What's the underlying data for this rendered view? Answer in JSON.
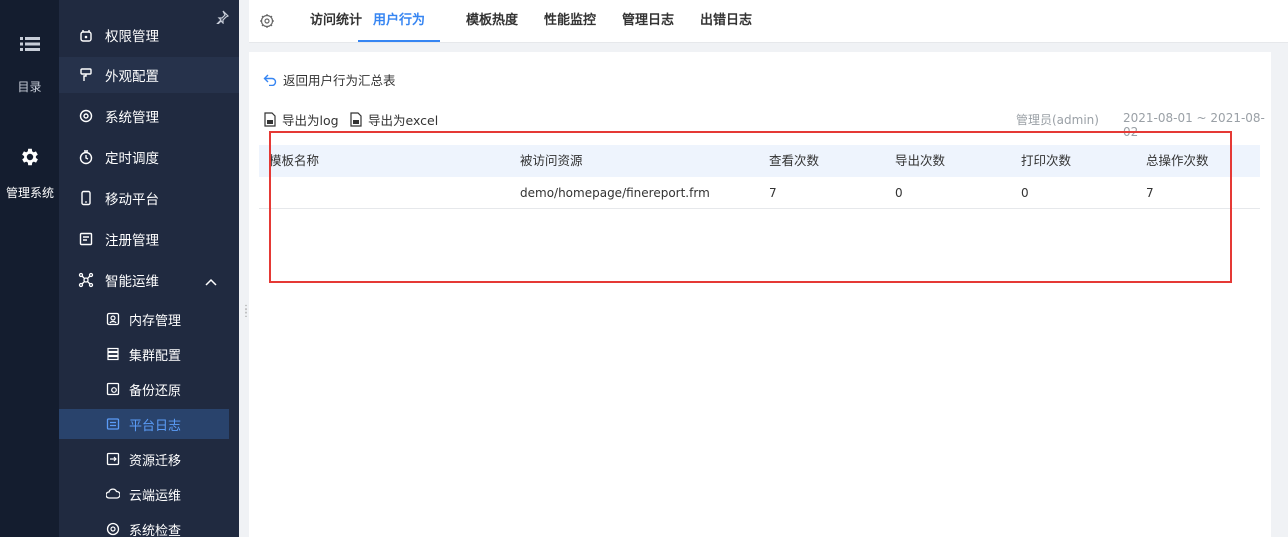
{
  "rail": {
    "menu": {
      "icon": "list-icon",
      "label": "目录"
    },
    "system": {
      "icon": "gear-icon",
      "label": "管理系统"
    }
  },
  "sidebar": {
    "items": [
      {
        "label": "权限管理",
        "icon": "permission-icon"
      },
      {
        "label": "外观配置",
        "icon": "brush-icon"
      },
      {
        "label": "系统管理",
        "icon": "settings-icon"
      },
      {
        "label": "定时调度",
        "icon": "timer-icon"
      },
      {
        "label": "移动平台",
        "icon": "mobile-icon"
      },
      {
        "label": "注册管理",
        "icon": "register-icon"
      },
      {
        "label": "智能运维",
        "icon": "ops-icon"
      }
    ],
    "subitems": [
      {
        "label": "内存管理",
        "icon": "memory-icon"
      },
      {
        "label": "集群配置",
        "icon": "cluster-icon"
      },
      {
        "label": "备份还原",
        "icon": "backup-icon"
      },
      {
        "label": "平台日志",
        "icon": "log-icon"
      },
      {
        "label": "资源迁移",
        "icon": "migrate-icon"
      },
      {
        "label": "云端运维",
        "icon": "cloud-icon"
      },
      {
        "label": "系统检查",
        "icon": "check-icon"
      }
    ],
    "active_sub": "平台日志"
  },
  "tabs": [
    "访问统计",
    "用户行为",
    "模板热度",
    "性能监控",
    "管理日志",
    "出错日志"
  ],
  "active_tab": "用户行为",
  "content": {
    "back_label": "返回用户行为汇总表",
    "export_log": "导出为log",
    "export_excel": "导出为excel",
    "user": "管理员(admin)",
    "date_range": "2021-08-01 ~ 2021-08-02"
  },
  "table": {
    "headers": [
      "模板名称",
      "被访问资源",
      "查看次数",
      "导出次数",
      "打印次数",
      "总操作次数"
    ],
    "rows": [
      [
        "",
        "demo/homepage/finereport.frm",
        "7",
        "0",
        "0",
        "7"
      ]
    ]
  },
  "colors": {
    "accent": "#3685f2",
    "sidebar": "#202a40",
    "rail": "#141d2f",
    "highlight": "#e53935"
  }
}
